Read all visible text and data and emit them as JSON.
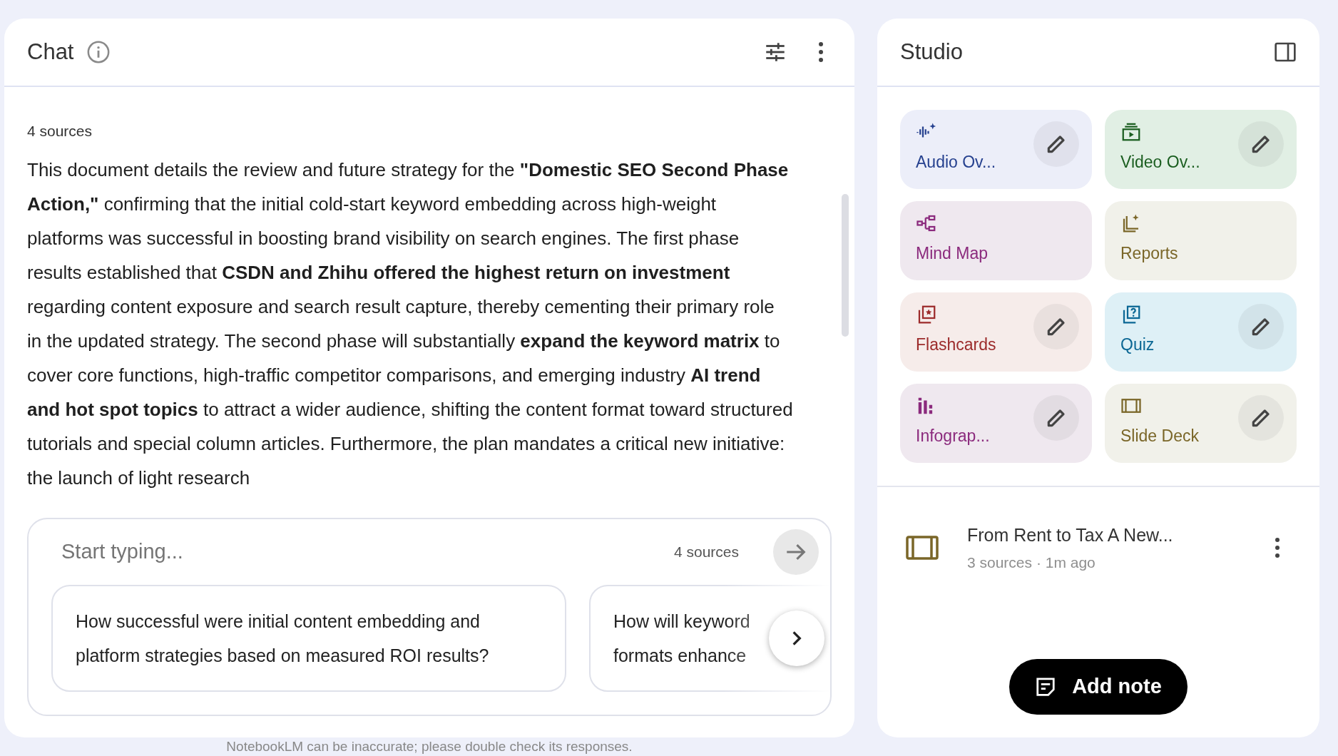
{
  "chat": {
    "title": "Chat",
    "sources_label": "4 sources",
    "message": "This document details the review and future strategy for the **\"Domestic SEO Second Phase Action,\"** confirming that the initial cold-start keyword embedding across high-weight platforms was successful in boosting brand visibility on search engines. The first phase results established that **CSDN and Zhihu offered the highest return on investment** regarding content exposure and search result capture, thereby cementing their primary role in the updated strategy. The second phase will substantially **expand the keyword matrix** to cover core functions, high-traffic competitor comparisons, and emerging industry **AI trend and hot spot topics** to attract a wider audience, shifting the content format toward structured tutorials and special column articles. Furthermore, the plan mandates a critical new initiative: the launch of light research",
    "input": {
      "placeholder": "Start typing...",
      "sources": "4 sources"
    },
    "suggestions": [
      {
        "text": "How successful were initial content embedding and platform strategies based on measured ROI results?"
      },
      {
        "text": "How will keyword formats enhance"
      }
    ],
    "disclaimer": "NotebookLM can be inaccurate; please double check its responses."
  },
  "studio": {
    "title": "Studio",
    "tools": [
      {
        "kind": "audio",
        "label": "Audio Ov...",
        "color": "#26418f",
        "editable": true
      },
      {
        "kind": "video",
        "label": "Video Ov...",
        "color": "#1b5e20",
        "editable": true
      },
      {
        "kind": "mindmap",
        "label": "Mind Map",
        "color": "#8b2a7d",
        "editable": false
      },
      {
        "kind": "reports",
        "label": "Reports",
        "color": "#7a6628",
        "editable": false
      },
      {
        "kind": "flashcards",
        "label": "Flashcards",
        "color": "#9c2b2b",
        "editable": true
      },
      {
        "kind": "quiz",
        "label": "Quiz",
        "color": "#0b6794",
        "editable": true
      },
      {
        "kind": "infographic",
        "label": "Infograp...",
        "color": "#8b2a7d",
        "editable": true
      },
      {
        "kind": "slides",
        "label": "Slide Deck",
        "color": "#7a6628",
        "editable": true
      }
    ],
    "notes": [
      {
        "title": "From Rent to Tax A New...",
        "meta": "3 sources · 1m ago"
      }
    ],
    "add_note": "Add note"
  }
}
